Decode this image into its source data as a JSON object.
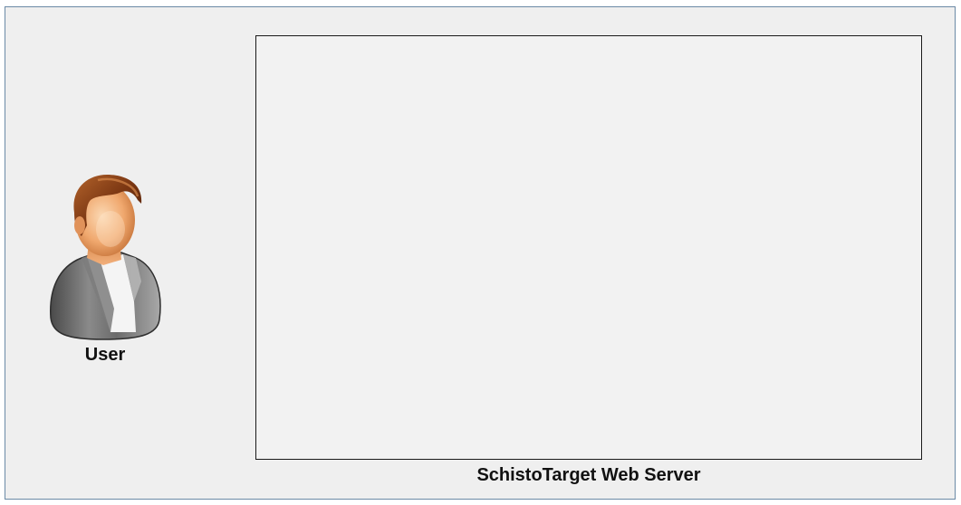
{
  "user": {
    "label": "User",
    "icon": "user-avatar-icon"
  },
  "server": {
    "label": "SchistoTarget Web Server"
  },
  "colors": {
    "canvas_background": "#efefef",
    "canvas_border": "#6b8aa6",
    "server_fill": "#f2f2f2",
    "server_border": "#1a1a1a"
  }
}
